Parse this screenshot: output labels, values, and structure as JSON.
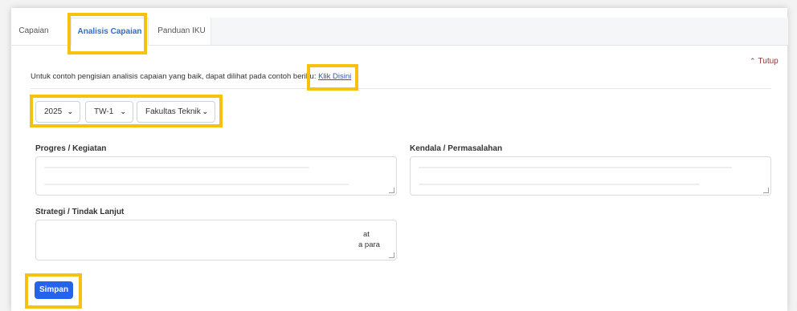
{
  "tabs": [
    {
      "label": "Capaian"
    },
    {
      "label": "Analisis Capaian"
    },
    {
      "label": "Panduan IKU"
    }
  ],
  "collapse_label": "Tutup",
  "info": {
    "text": "Untuk contoh pengisian analisis capaian yang baik, dapat dilihat pada contoh beriku",
    "link_label": "Klik Disini"
  },
  "filters": {
    "year": "2025",
    "period": "TW-1",
    "unit": "Fakultas Teknik"
  },
  "fields": {
    "progress_label": "Progres / Kegiatan",
    "obstacle_label": "Kendala / Permasalahan",
    "strategy_label": "Strategi / Tindak Lanjut",
    "strategy_value_line1": "at",
    "strategy_value_line2": "a para"
  },
  "submit_label": "Simpan",
  "colors": {
    "highlight": "#f6c10f",
    "accent": "#2563eb",
    "active_tab": "#2b6cd3"
  }
}
